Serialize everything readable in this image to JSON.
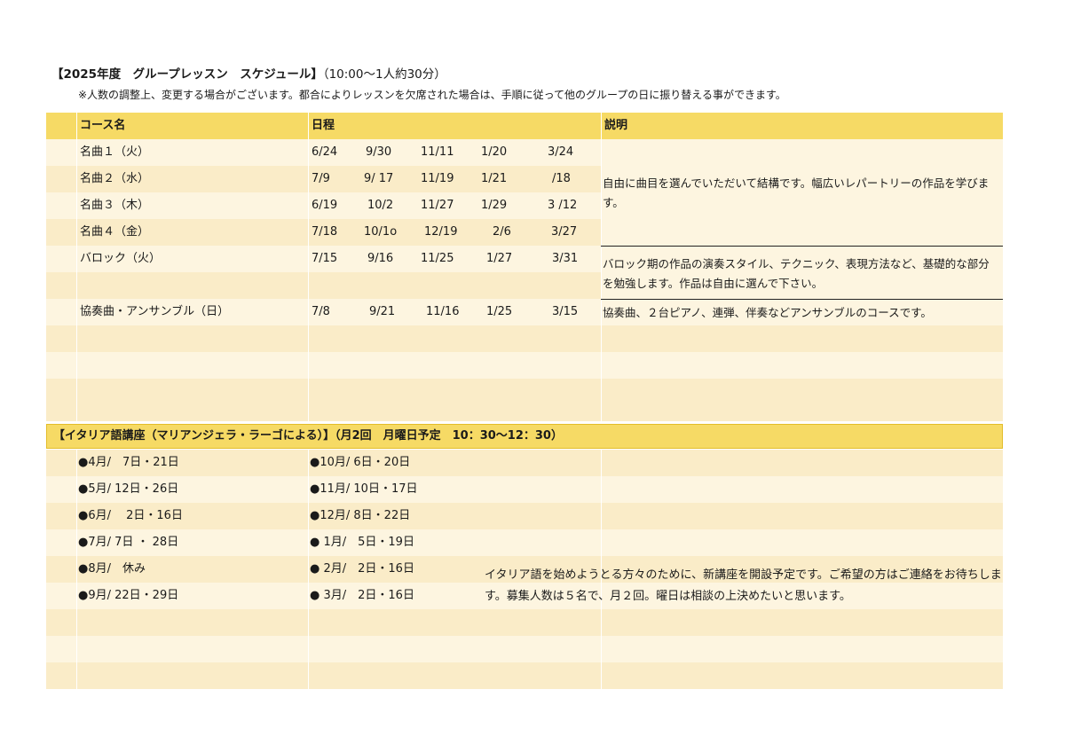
{
  "title": {
    "main": "【2025年度　グループレッスン　スケジュール】",
    "sub": "（10:00〜1人約30分）"
  },
  "note": "※人数の調整上、変更する場合がございます。都合によりレッスンを欠席された場合は、手順に従って他のグループの日に振り替える事ができます。",
  "table": {
    "headers": {
      "course": "コース名",
      "schedule": "日程",
      "description": "説明"
    },
    "rows": [
      {
        "course": "名曲１（火）",
        "dates": [
          "6/24",
          "9/30",
          "11/11",
          "1/20",
          "3/24"
        ]
      },
      {
        "course": "名曲２（水）",
        "dates": [
          "7/9",
          "9/ 17",
          "11/19",
          "1/21",
          "/18"
        ]
      },
      {
        "course": "名曲３（木）",
        "dates": [
          "6/19",
          "10/2",
          "11/27",
          "1/29",
          "3 /12"
        ]
      },
      {
        "course": "名曲４（金）",
        "dates": [
          "7/18",
          "10/1o",
          "12/19",
          "2/6",
          "3/27"
        ]
      },
      {
        "course": "バロック（火）",
        "dates": [
          "7/15",
          "9/16",
          "11/25",
          "1/27",
          "3/31"
        ]
      },
      {
        "course": "協奏曲・アンサンブル（日）",
        "dates": [
          "7/8",
          "9/21",
          "11/16",
          "1/25",
          "3/15"
        ]
      }
    ],
    "descriptions": {
      "meikyoku": "自由に曲目を選んでいただいて結構です。幅広いレパートリーの作品を学びます。",
      "baroque": "バロック期の作品の演奏スタイル、テクニック、表現方法など、基礎的な部分を勉強します。作品は自由に選んで下さい。",
      "concerto": "協奏曲、２台ピアノ、連弾、伴奏などアンサンブルのコースです。"
    }
  },
  "italian": {
    "title": "【イタリア語講座（マリアンジェラ・ラーゴによる）】（月2回　月曜日予定　10：30〜12：30）",
    "left": [
      "●4月/　7日・21日",
      "●5月/  12日・26日",
      "●6月/　 2日・16日",
      "●7月/  7日 ・ 28日",
      "●8月/　休み",
      "●9月/  22日・29日"
    ],
    "right": [
      "●10月/  6日・20日",
      "●11月/  10日・17日",
      "●12月/  8日・22日",
      "● 1月/　5日・19日",
      "● 2月/　2日・16日",
      "● 3月/　2日・16日"
    ],
    "description": "イタリア語を始めようとる方々のために、新講座を開設予定です。ご希望の方はご連絡をお待ちします。募集人数は５名で、月２回。曜日は相談の上決めたいと思います。"
  },
  "colors": {
    "header": "#f6da65",
    "row_light": "#fdf5e0",
    "row_mid": "#faecc8",
    "border": "#e3bd2a"
  }
}
